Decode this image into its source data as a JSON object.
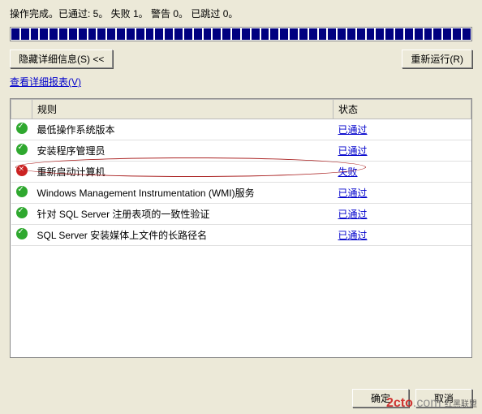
{
  "status_line": "操作完成。已通过: 5。 失败 1。 警告 0。 已跳过 0。",
  "buttons": {
    "hide_details": "隐藏详细信息(S) <<",
    "rerun": "重新运行(R)",
    "ok": "确定",
    "cancel": "取消"
  },
  "links": {
    "view_report": "查看详细报表(V)"
  },
  "table": {
    "headers": {
      "rule": "规则",
      "status": "状态"
    },
    "rows": [
      {
        "icon": "pass",
        "rule": "最低操作系统版本",
        "status": "已通过",
        "status_type": "pass"
      },
      {
        "icon": "pass",
        "rule": "安装程序管理员",
        "status": "已通过",
        "status_type": "pass"
      },
      {
        "icon": "fail",
        "rule": "重新启动计算机",
        "status": "失败",
        "status_type": "fail"
      },
      {
        "icon": "pass",
        "rule": "Windows Management Instrumentation (WMI)服务",
        "status": "已通过",
        "status_type": "pass"
      },
      {
        "icon": "pass",
        "rule": "针对 SQL Server 注册表项的一致性验证",
        "status": "已通过",
        "status_type": "pass"
      },
      {
        "icon": "pass",
        "rule": "SQL Server 安装媒体上文件的长路径名",
        "status": "已通过",
        "status_type": "pass"
      }
    ]
  },
  "watermark": {
    "text_a": "2cto",
    "text_b": ".com",
    "sub": "红黑联盟"
  }
}
